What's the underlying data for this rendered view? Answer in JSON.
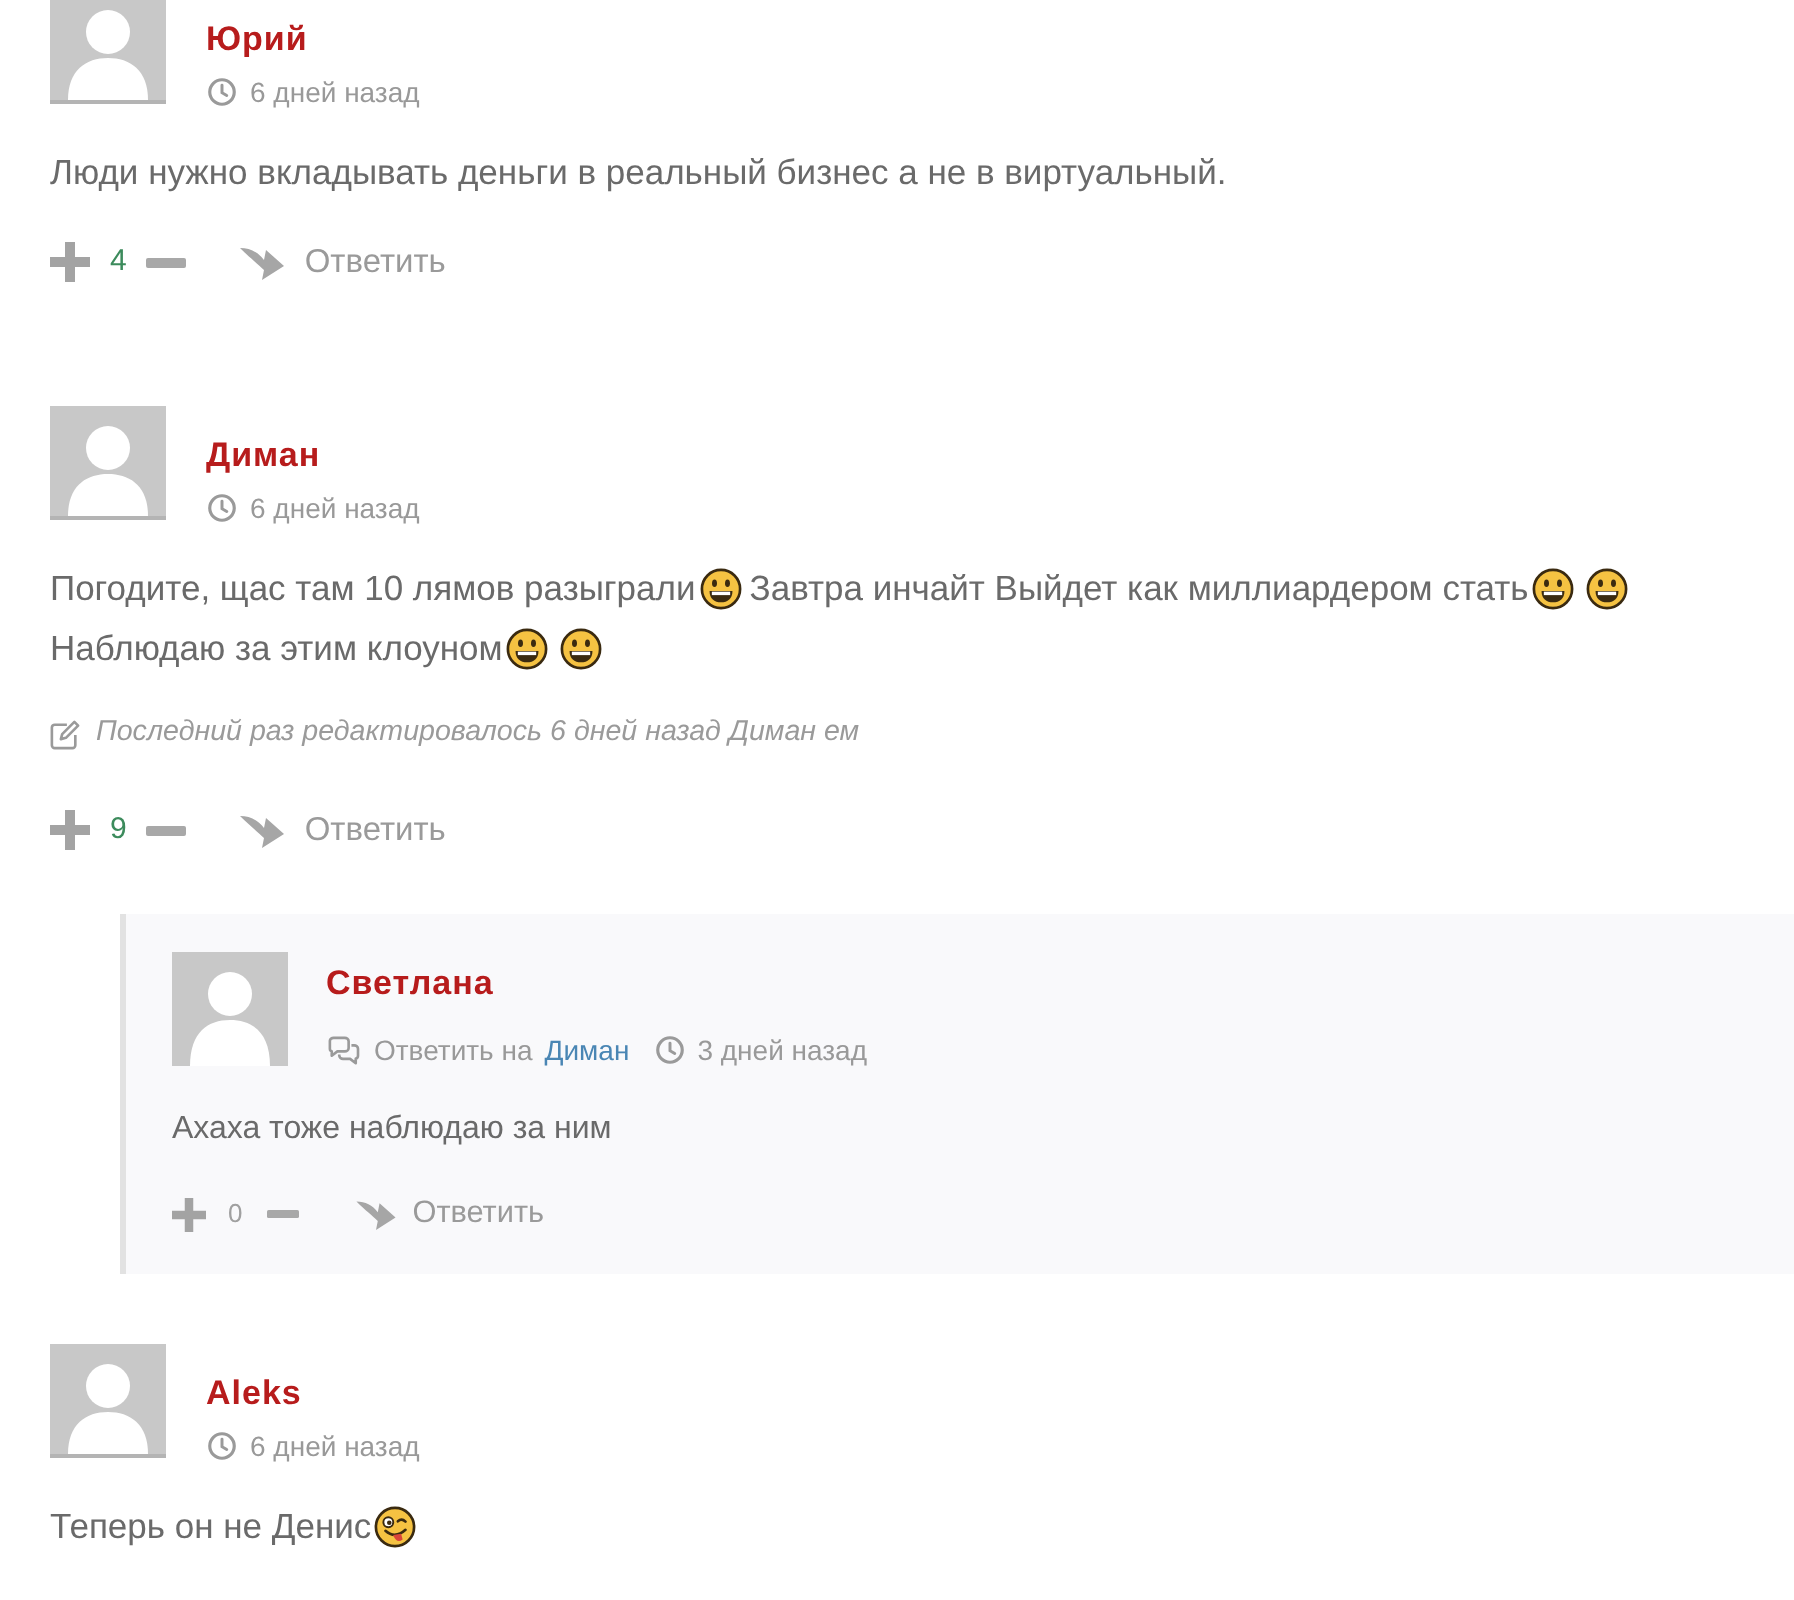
{
  "comments": [
    {
      "author": "Юрий",
      "time": "6 дней назад",
      "lines": [
        [
          {
            "kind": "text",
            "text": "Люди нужно вкладывать деньги в реальный бизнес а не в виртуальный."
          }
        ]
      ],
      "actions": {
        "score": "4",
        "positive": true,
        "reply_label": "Ответить"
      }
    },
    {
      "author": "Диман",
      "time": "6 дней назад",
      "lines": [
        [
          {
            "kind": "text",
            "text": "Погодите, щас там 10 лямов разыграли"
          },
          {
            "kind": "grin"
          },
          {
            "kind": "text",
            "text": "Завтра инчайт Выйдет как миллиардером стать"
          },
          {
            "kind": "grin"
          },
          {
            "kind": "grin"
          }
        ],
        [
          {
            "kind": "text",
            "text": "Наблюдаю за этим клоуном"
          },
          {
            "kind": "grin"
          },
          {
            "kind": "grin"
          }
        ]
      ],
      "edit_note": "Последний раз редактировалось 6 дней назад Диман ем",
      "actions": {
        "score": "9",
        "positive": true,
        "reply_label": "Ответить"
      },
      "replies": [
        {
          "author": "Светлана",
          "reply_to": {
            "label": "Ответить на",
            "name": "Диман"
          },
          "time": "3 дней назад",
          "lines": [
            [
              {
                "kind": "text",
                "text": "Ахаха тоже наблюдаю за ним"
              }
            ]
          ],
          "actions": {
            "score": "0",
            "positive": false,
            "reply_label": "Ответить"
          }
        }
      ]
    },
    {
      "author": "Aleks",
      "time": "6 дней назад",
      "lines": [
        [
          {
            "kind": "text",
            "text": "Теперь он не Денис"
          },
          {
            "kind": "silly"
          }
        ]
      ]
    }
  ]
}
